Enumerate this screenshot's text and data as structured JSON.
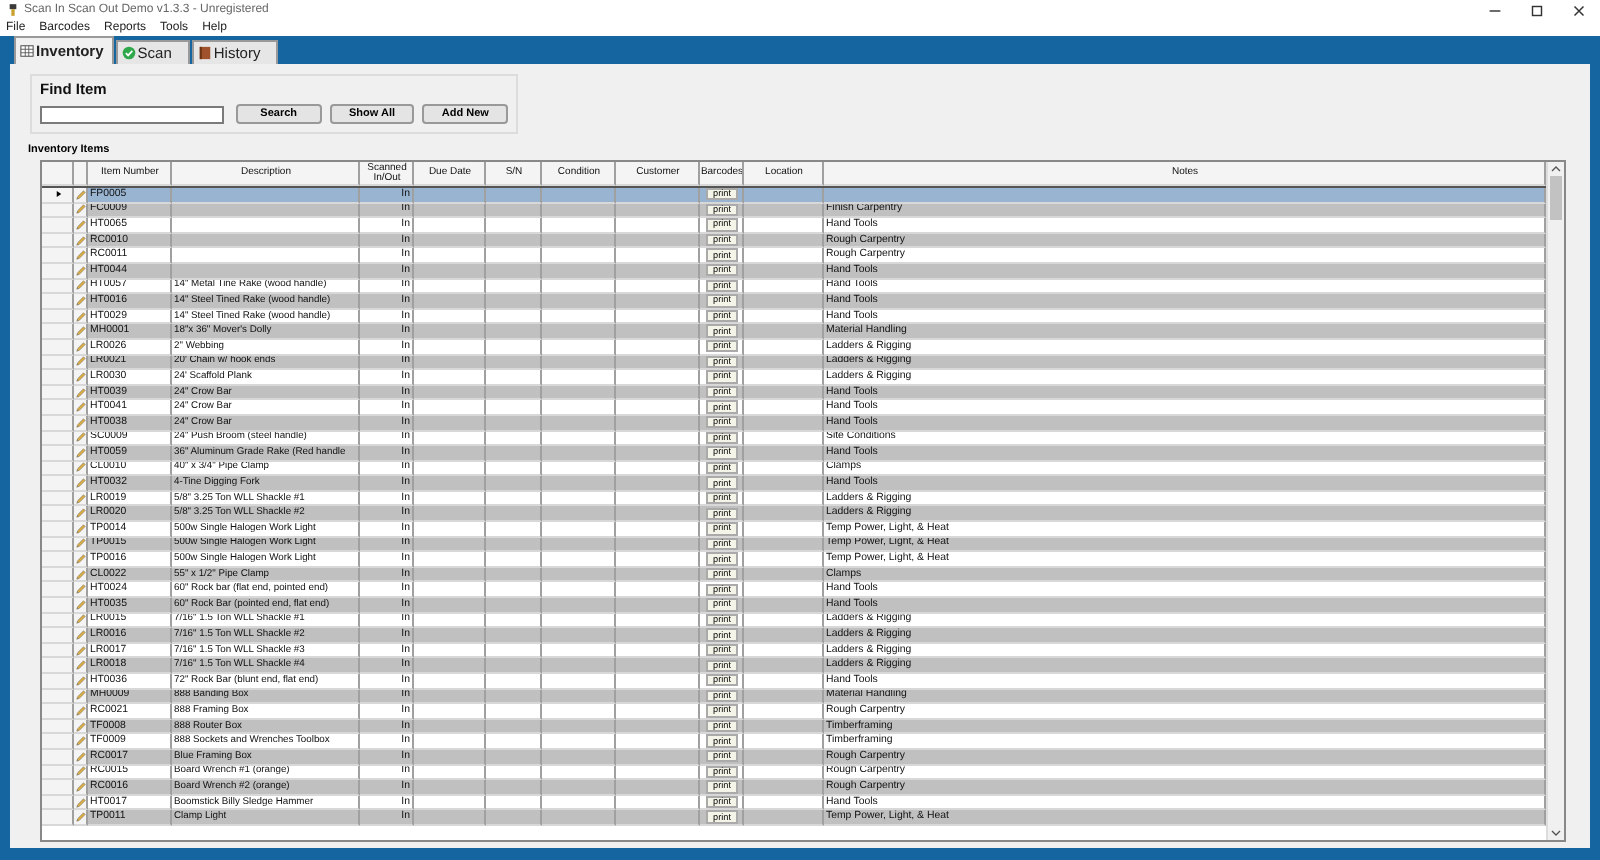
{
  "window": {
    "title": "Scan In Scan Out Demo v1.3.3 - Unregistered"
  },
  "menu": [
    "File",
    "Barcodes",
    "Reports",
    "Tools",
    "Help"
  ],
  "tabs": [
    {
      "label": "Inventory",
      "selected": true
    },
    {
      "label": "Scan",
      "selected": false
    },
    {
      "label": "History",
      "selected": false
    }
  ],
  "find_item": {
    "title": "Find Item",
    "buttons": [
      "Search",
      "Show All",
      "Add New"
    ]
  },
  "table": {
    "title": "Inventory Items",
    "columns": [
      "Item Number",
      "Description",
      "Scanned In/Out",
      "Due Date",
      "S/N",
      "Condition",
      "Customer",
      "Barcodes",
      "Location",
      "Notes"
    ],
    "rows": [
      {
        "item_number": "FP0005",
        "description": "",
        "scanned": "In",
        "barcode": "print",
        "notes": "",
        "selected": true
      },
      {
        "item_number": "FC0009",
        "description": "",
        "scanned": "In",
        "barcode": "print",
        "notes": "Finish Carpentry",
        "selected": false
      },
      {
        "item_number": "HT0065",
        "description": "",
        "scanned": "In",
        "barcode": "print",
        "notes": "Hand Tools",
        "selected": false
      },
      {
        "item_number": "RC0010",
        "description": "",
        "scanned": "In",
        "barcode": "print",
        "notes": "Rough Carpentry",
        "selected": false
      },
      {
        "item_number": "RC0011",
        "description": "",
        "scanned": "In",
        "barcode": "print",
        "notes": "Rough Carpentry",
        "selected": false
      },
      {
        "item_number": "HT0044",
        "description": "",
        "scanned": "In",
        "barcode": "print",
        "notes": "Hand Tools",
        "selected": false
      },
      {
        "item_number": "HT0057",
        "description": "14\" Metal Tine Rake (wood handle)",
        "scanned": "In",
        "barcode": "print",
        "notes": "Hand Tools",
        "selected": false
      },
      {
        "item_number": "HT0016",
        "description": "14\" Steel Tined Rake (wood handle)",
        "scanned": "In",
        "barcode": "print",
        "notes": "Hand Tools",
        "selected": false
      },
      {
        "item_number": "HT0029",
        "description": "14\" Steel Tined Rake (wood handle)",
        "scanned": "In",
        "barcode": "print",
        "notes": "Hand Tools",
        "selected": false
      },
      {
        "item_number": "MH0001",
        "description": "18\"x 36\" Mover's Dolly",
        "scanned": "In",
        "barcode": "print",
        "notes": "Material Handling",
        "selected": false
      },
      {
        "item_number": "LR0026",
        "description": "2\" Webbing",
        "scanned": "In",
        "barcode": "print",
        "notes": "Ladders & Rigging",
        "selected": false
      },
      {
        "item_number": "LR0021",
        "description": "20' Chain w/ hook ends",
        "scanned": "In",
        "barcode": "print",
        "notes": "Ladders & Rigging",
        "selected": false
      },
      {
        "item_number": "LR0030",
        "description": "24' Scaffold Plank",
        "scanned": "In",
        "barcode": "print",
        "notes": "Ladders & Rigging",
        "selected": false
      },
      {
        "item_number": "HT0039",
        "description": "24\" Crow Bar",
        "scanned": "In",
        "barcode": "print",
        "notes": "Hand Tools",
        "selected": false
      },
      {
        "item_number": "HT0041",
        "description": "24\" Crow Bar",
        "scanned": "In",
        "barcode": "print",
        "notes": "Hand Tools",
        "selected": false
      },
      {
        "item_number": "HT0038",
        "description": "24\" Crow Bar",
        "scanned": "In",
        "barcode": "print",
        "notes": "Hand Tools",
        "selected": false
      },
      {
        "item_number": "SC0009",
        "description": "24\" Push Broom (steel handle)",
        "scanned": "In",
        "barcode": "print",
        "notes": "Site Conditions",
        "selected": false
      },
      {
        "item_number": "HT0059",
        "description": "36\" Aluminum Grade Rake (Red handle",
        "scanned": "In",
        "barcode": "print",
        "notes": "Hand Tools",
        "selected": false
      },
      {
        "item_number": "CL0010",
        "description": "40\" x 3/4\" Pipe Clamp",
        "scanned": "In",
        "barcode": "print",
        "notes": "Clamps",
        "selected": false
      },
      {
        "item_number": "HT0032",
        "description": "4-Tine Digging Fork",
        "scanned": "In",
        "barcode": "print",
        "notes": "Hand Tools",
        "selected": false
      },
      {
        "item_number": "LR0019",
        "description": "5/8\" 3.25 Ton WLL Shackle #1",
        "scanned": "In",
        "barcode": "print",
        "notes": "Ladders & Rigging",
        "selected": false
      },
      {
        "item_number": "LR0020",
        "description": "5/8\" 3.25 Ton WLL Shackle #2",
        "scanned": "In",
        "barcode": "print",
        "notes": "Ladders & Rigging",
        "selected": false
      },
      {
        "item_number": "TP0014",
        "description": "500w Single Halogen Work Light",
        "scanned": "In",
        "barcode": "print",
        "notes": "Temp Power, Light, & Heat",
        "selected": false
      },
      {
        "item_number": "TP0015",
        "description": "500w Single Halogen Work Light",
        "scanned": "In",
        "barcode": "print",
        "notes": "Temp Power, Light, & Heat",
        "selected": false
      },
      {
        "item_number": "TP0016",
        "description": "500w Single Halogen Work Light",
        "scanned": "In",
        "barcode": "print",
        "notes": "Temp Power, Light, & Heat",
        "selected": false
      },
      {
        "item_number": "CL0022",
        "description": "55\" x 1/2\" Pipe Clamp",
        "scanned": "In",
        "barcode": "print",
        "notes": "Clamps",
        "selected": false
      },
      {
        "item_number": "HT0024",
        "description": "60\" Rock bar (flat end, pointed end)",
        "scanned": "In",
        "barcode": "print",
        "notes": "Hand Tools",
        "selected": false
      },
      {
        "item_number": "HT0035",
        "description": "60\" Rock Bar (pointed end, flat end)",
        "scanned": "In",
        "barcode": "print",
        "notes": "Hand Tools",
        "selected": false
      },
      {
        "item_number": "LR0015",
        "description": "7/16\" 1.5 Ton WLL Shackle #1",
        "scanned": "In",
        "barcode": "print",
        "notes": "Ladders & Rigging",
        "selected": false
      },
      {
        "item_number": "LR0016",
        "description": "7/16\" 1.5 Ton WLL Shackle #2",
        "scanned": "In",
        "barcode": "print",
        "notes": "Ladders & Rigging",
        "selected": false
      },
      {
        "item_number": "LR0017",
        "description": "7/16\" 1.5 Ton WLL Shackle #3",
        "scanned": "In",
        "barcode": "print",
        "notes": "Ladders & Rigging",
        "selected": false
      },
      {
        "item_number": "LR0018",
        "description": "7/16\" 1.5 Ton WLL Shackle #4",
        "scanned": "In",
        "barcode": "print",
        "notes": "Ladders & Rigging",
        "selected": false
      },
      {
        "item_number": "HT0036",
        "description": "72\" Rock Bar (blunt end, flat end)",
        "scanned": "In",
        "barcode": "print",
        "notes": "Hand Tools",
        "selected": false
      },
      {
        "item_number": "MH0009",
        "description": "888 Banding Box",
        "scanned": "In",
        "barcode": "print",
        "notes": "Material Handling",
        "selected": false
      },
      {
        "item_number": "RC0021",
        "description": "888 Framing Box",
        "scanned": "In",
        "barcode": "print",
        "notes": "Rough Carpentry",
        "selected": false
      },
      {
        "item_number": "TF0008",
        "description": "888 Router Box",
        "scanned": "In",
        "barcode": "print",
        "notes": "Timberframing",
        "selected": false
      },
      {
        "item_number": "TF0009",
        "description": "888 Sockets and Wrenches Toolbox",
        "scanned": "In",
        "barcode": "print",
        "notes": "Timberframing",
        "selected": false
      },
      {
        "item_number": "RC0017",
        "description": "Blue Framing Box",
        "scanned": "In",
        "barcode": "print",
        "notes": "Rough Carpentry",
        "selected": false
      },
      {
        "item_number": "RC0015",
        "description": "Board Wrench #1 (orange)",
        "scanned": "In",
        "barcode": "print",
        "notes": "Rough Carpentry",
        "selected": false
      },
      {
        "item_number": "RC0016",
        "description": "Board Wrench #2 (orange)",
        "scanned": "In",
        "barcode": "print",
        "notes": "Rough Carpentry",
        "selected": false
      },
      {
        "item_number": "HT0017",
        "description": "Boomstick Billy Sledge Hammer",
        "scanned": "In",
        "barcode": "print",
        "notes": "Hand Tools",
        "selected": false
      },
      {
        "item_number": "TP0011",
        "description": "Clamp Light",
        "scanned": "In",
        "barcode": "print",
        "notes": "Temp Power, Light, & Heat",
        "selected": false
      }
    ]
  }
}
